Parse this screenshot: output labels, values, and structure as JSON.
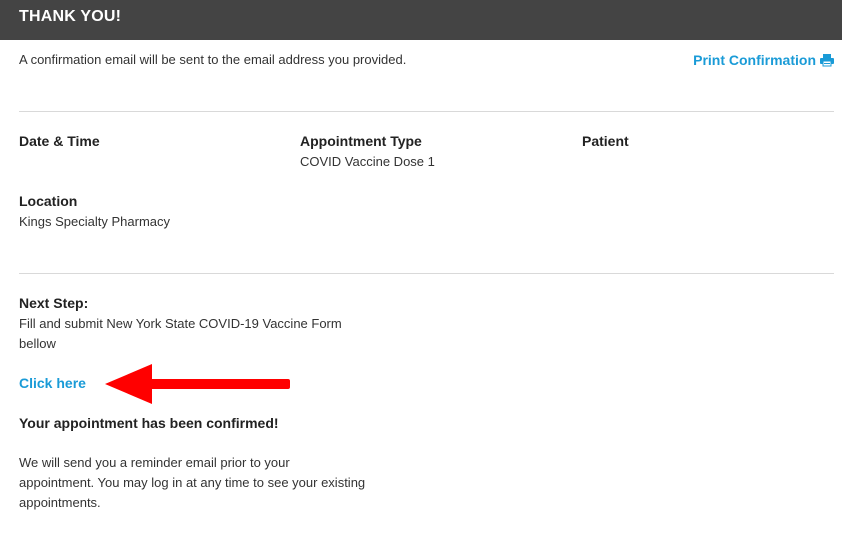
{
  "header": {
    "title": "THANK YOU!"
  },
  "confirmation": {
    "message": "A confirmation email will be sent to the email address you provided.",
    "print_label": "Print Confirmation",
    "print_icon": "printer-icon"
  },
  "details": {
    "date_time_label": "Date & Time",
    "appointment_type_label": "Appointment Type",
    "appointment_type_value": "COVID Vaccine Dose 1",
    "patient_label": "Patient",
    "location_label": "Location",
    "location_value": "Kings Specialty Pharmacy"
  },
  "next_step": {
    "label": "Next Step:",
    "line1": "Fill and submit New York State COVID-19 Vaccine Form",
    "line2": "bellow",
    "link_label": "Click here"
  },
  "confirmed": {
    "heading": "Your appointment has been confirmed!",
    "line1": "We will send you a reminder email prior to your",
    "line2": "appointment. You may log in at any time to see your existing",
    "line3": "appointments."
  },
  "colors": {
    "header_bg": "#444444",
    "link": "#1a9bd7",
    "arrow": "#ff0000"
  }
}
